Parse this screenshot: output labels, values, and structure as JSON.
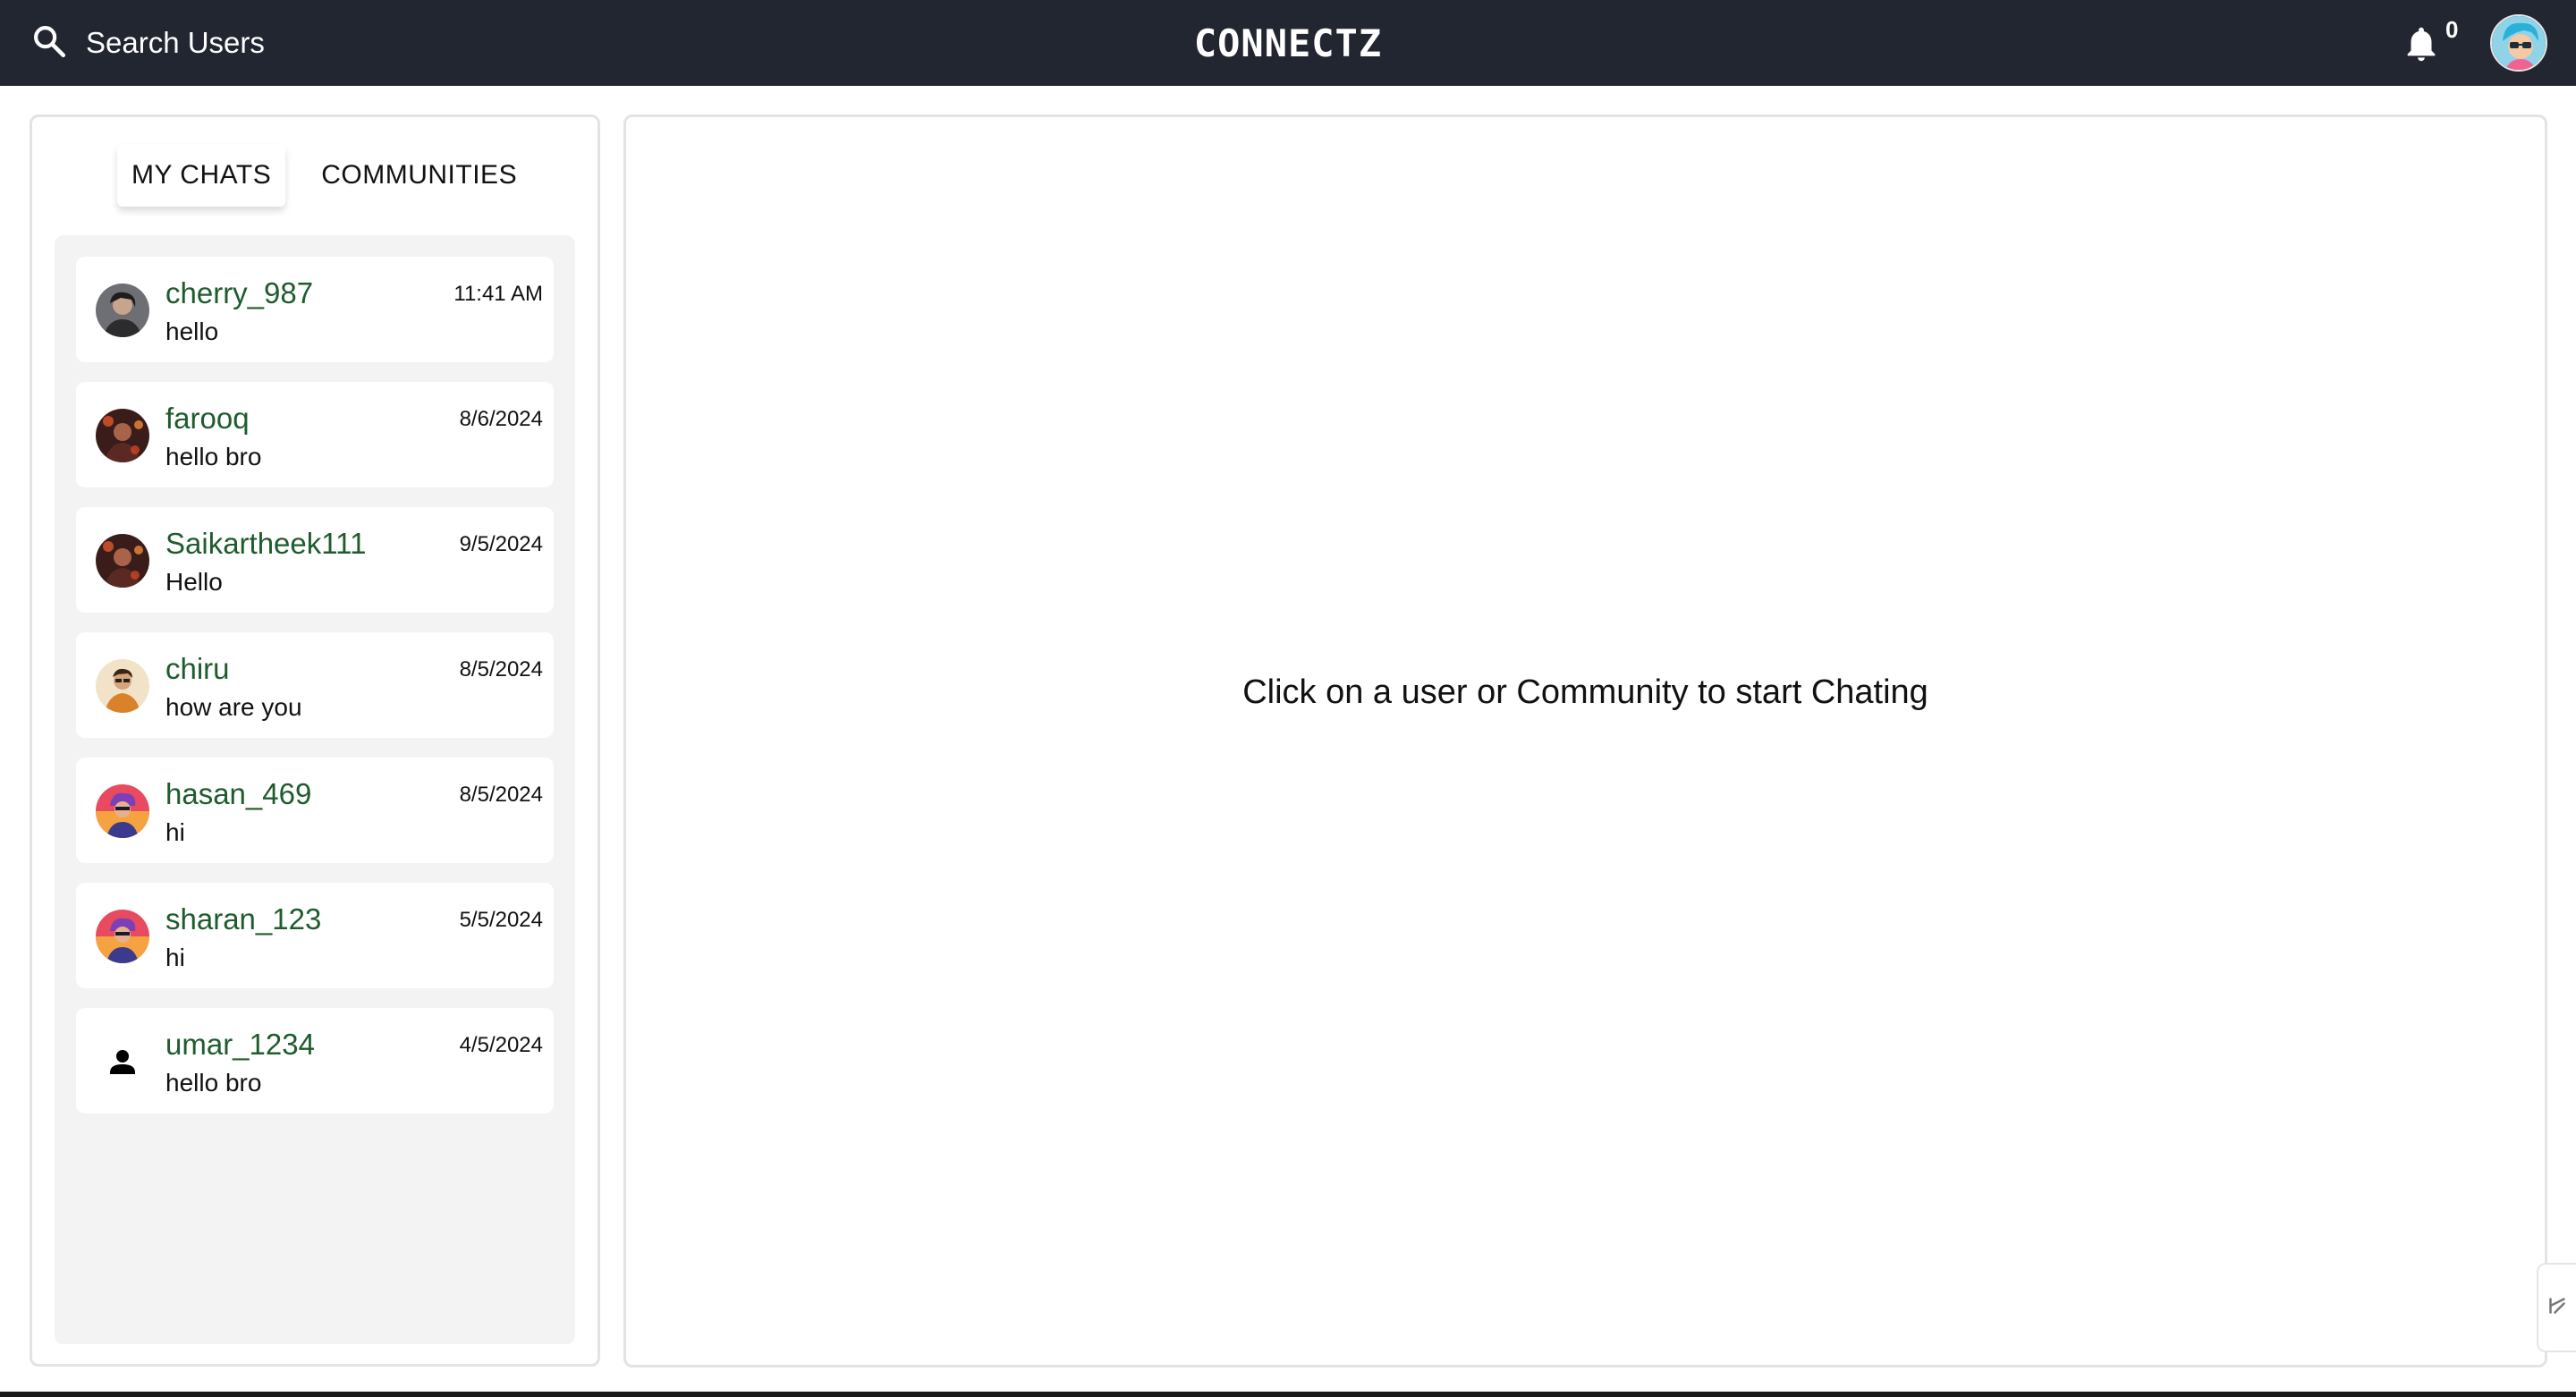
{
  "header": {
    "search_label": "Search Users",
    "brand": "CONNECTZ",
    "notification_count": "0",
    "icons": {
      "search": "search-icon",
      "notifications": "bell-icon",
      "profile": "avatar"
    }
  },
  "sidebar": {
    "tabs": [
      {
        "label": "MY CHATS",
        "active": true
      },
      {
        "label": "COMMUNITIES",
        "active": false
      }
    ],
    "chats": [
      {
        "name": "cherry_987",
        "message": "hello",
        "time": "11:41 AM",
        "avatar": "avatar-dark"
      },
      {
        "name": "farooq",
        "message": "hello bro",
        "time": "8/6/2024",
        "avatar": "avatar-fire"
      },
      {
        "name": "Saikartheek111",
        "message": "Hello",
        "time": "9/5/2024",
        "avatar": "avatar-fire"
      },
      {
        "name": "chiru",
        "message": "how are you",
        "time": "8/5/2024",
        "avatar": "avatar-warm"
      },
      {
        "name": "hasan_469",
        "message": "hi",
        "time": "8/5/2024",
        "avatar": "avatar-pink"
      },
      {
        "name": "sharan_123",
        "message": "hi",
        "time": "5/5/2024",
        "avatar": "avatar-pink"
      },
      {
        "name": "umar_1234",
        "message": "hello bro",
        "time": "4/5/2024",
        "avatar": "person-icon"
      }
    ]
  },
  "main": {
    "empty_message": "Click on a user or Community to start Chating"
  },
  "colors": {
    "topbar": "#212631",
    "username": "#1e5c2e",
    "list_bg": "#f3f3f3"
  }
}
